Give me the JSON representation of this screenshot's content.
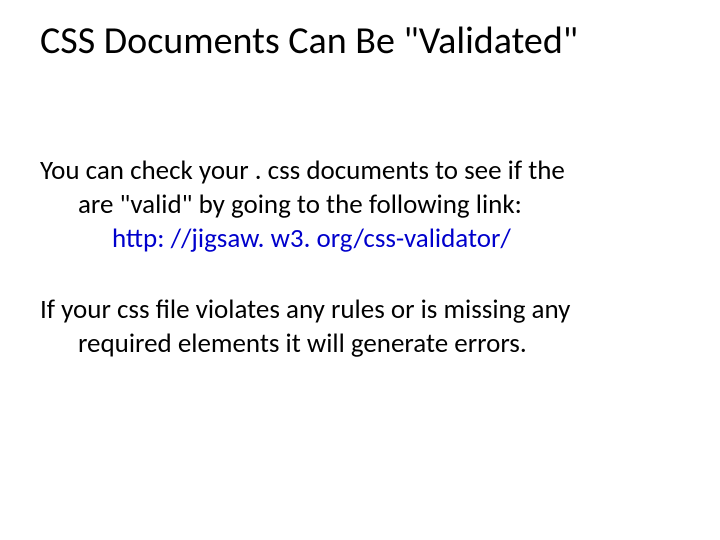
{
  "title": "CSS Documents Can Be \"Validated\"",
  "para1_line1": "You can check your . css documents to see if the",
  "para1_line2": "are \"valid\" by going to the following link:",
  "link": "http: //jigsaw. w3. org/css-validator/",
  "para2_line1": "If your css file violates any rules or is missing any",
  "para2_line2": "required elements it will generate errors."
}
